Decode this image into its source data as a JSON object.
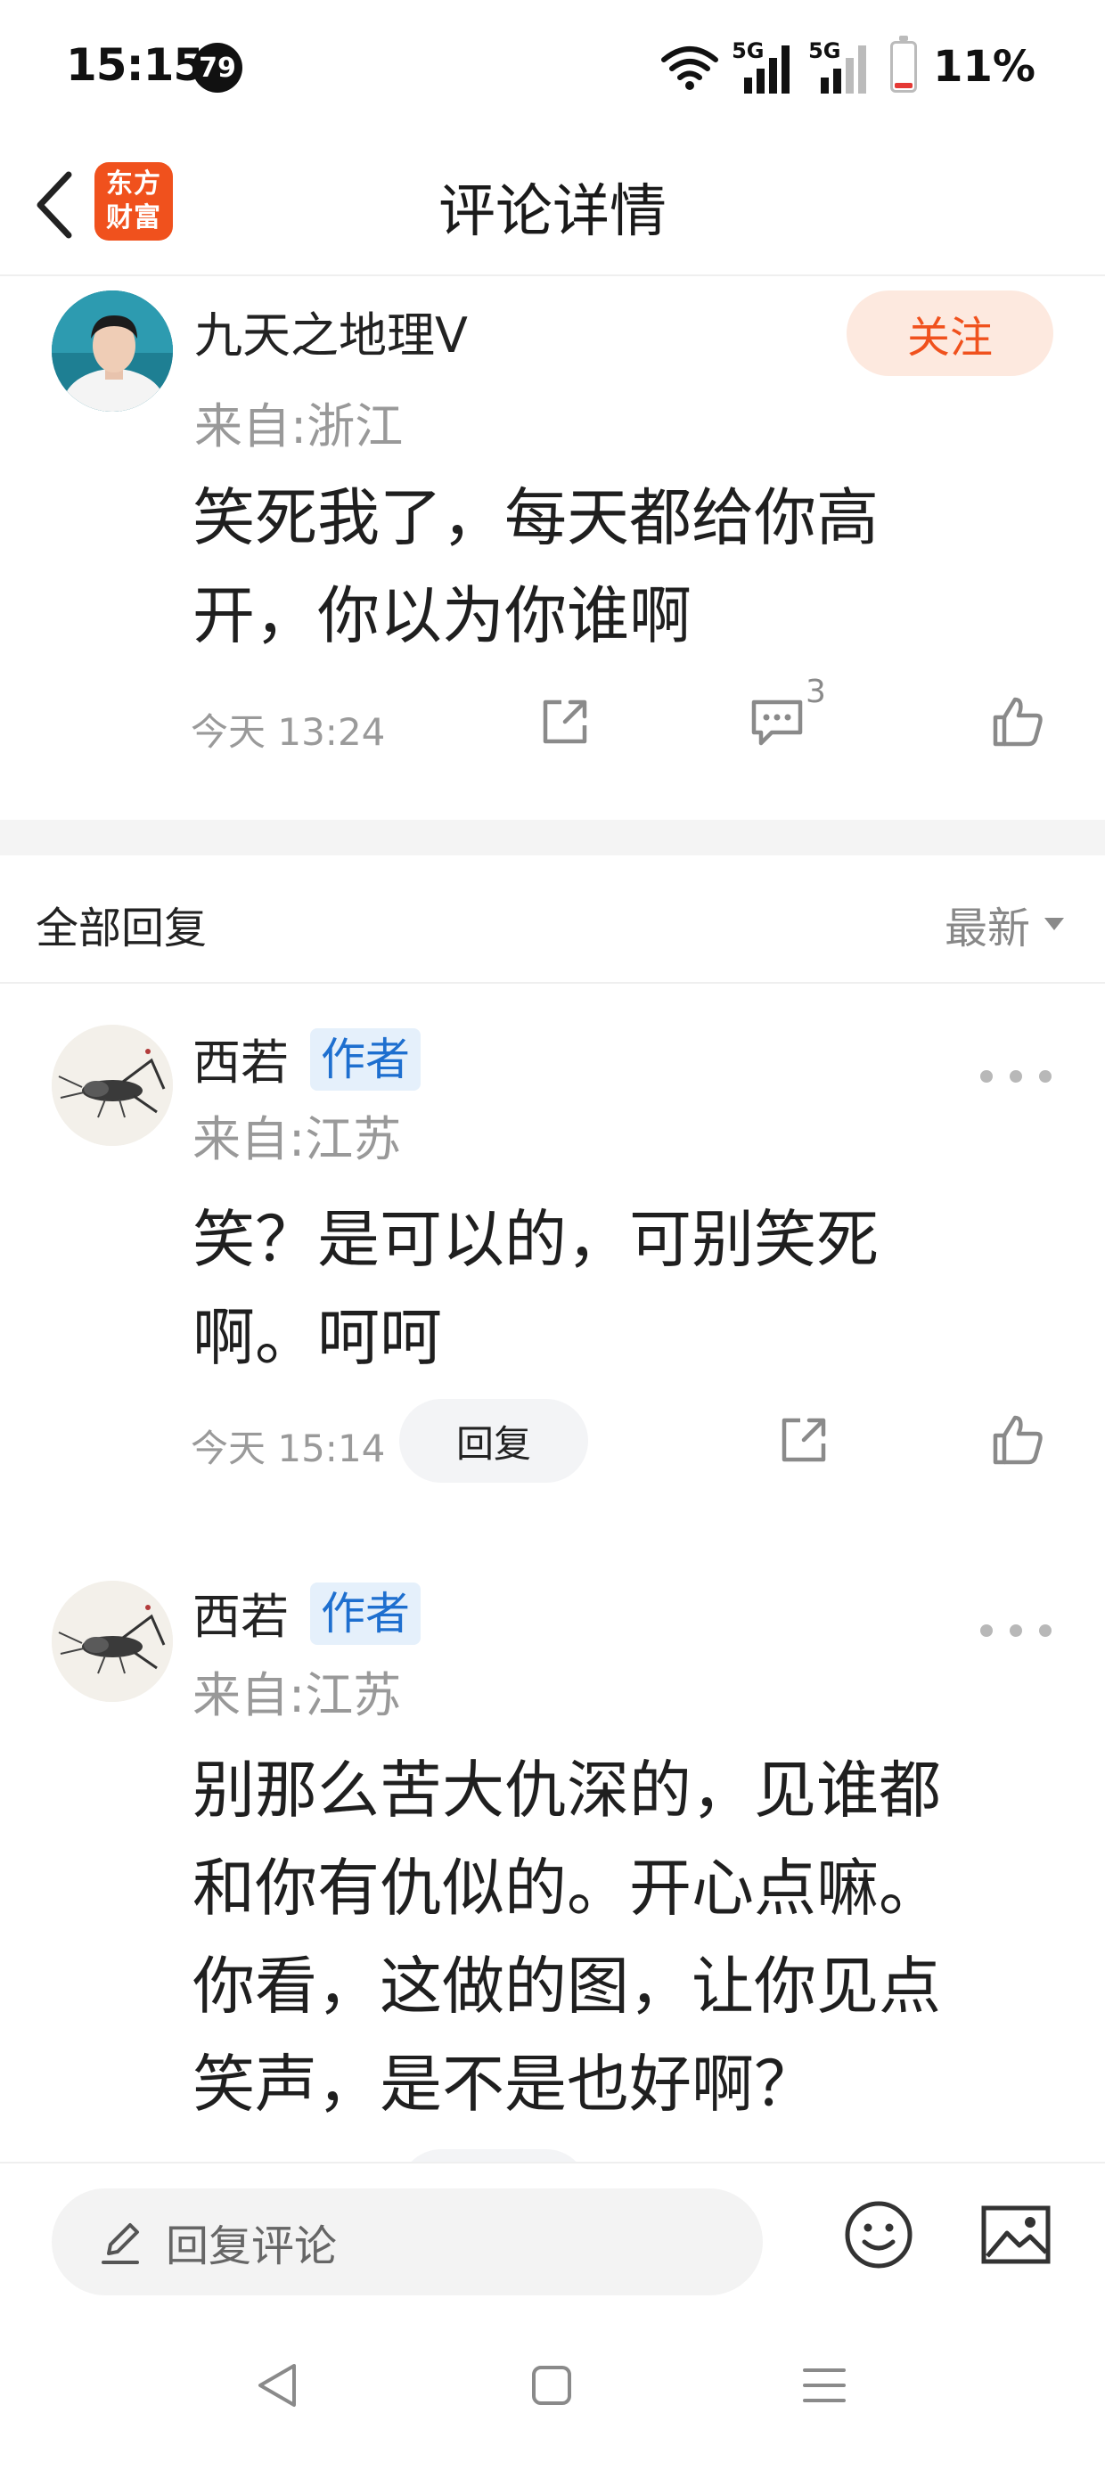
{
  "status_bar": {
    "time": "15:15",
    "notification_count": "79",
    "network_1": "5G",
    "network_2": "5G",
    "battery": "11%",
    "battery_level": 0.11,
    "battery_color": "#e53935"
  },
  "nav": {
    "title": "评论详情",
    "logo_line1": "东方",
    "logo_line2": "财富",
    "brand_color": "#f0511d"
  },
  "top_comment": {
    "username": "九天之地理V",
    "location": "来自:浙江",
    "follow_label": "关注",
    "text_line1": "笑死我了，每天都给你高",
    "text_line2": "开，你以为你谁啊",
    "time": "今天 13:24",
    "comment_count": "3"
  },
  "replies": {
    "header": "全部回复",
    "sort_label": "最新",
    "items": [
      {
        "username": "西若",
        "tag": "作者",
        "location": "来自:江苏",
        "line1": "笑？是可以的，可别笑死",
        "line2": "啊。呵呵",
        "time": "今天 15:14",
        "reply_label": "回复"
      },
      {
        "username": "西若",
        "tag": "作者",
        "location": "来自:江苏",
        "line1": "别那么苦大仇深的，见谁都",
        "line2": "和你有仇似的。开心点嘛。",
        "line3": "你看，这做的图，让你见点",
        "line4": "笑声，是不是也好啊？"
      }
    ]
  },
  "bottom_bar": {
    "input_placeholder": "回复评论"
  }
}
